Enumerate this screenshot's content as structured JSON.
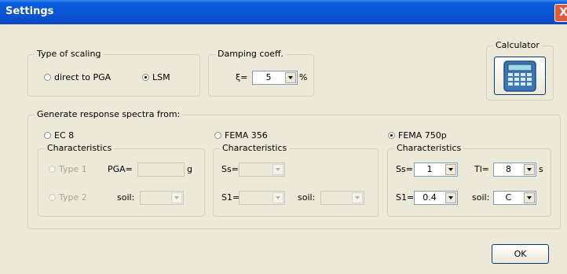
{
  "window": {
    "title": "Settings",
    "close_glyph": "X"
  },
  "scaling": {
    "legend": "Type of scaling",
    "opt1": "direct to PGA",
    "opt2": "LSM",
    "selected": "LSM"
  },
  "damping": {
    "legend": "Damping coeff.",
    "symbol": "ξ=",
    "value": "5",
    "unit": "%"
  },
  "calculator": {
    "label": "Calculator",
    "icon": "calculator-icon"
  },
  "generate": {
    "legend": "Generate response spectra from:"
  },
  "ec8": {
    "label": "EC 8",
    "selected": false,
    "characteristics": "Characteristics",
    "type1": "Type 1",
    "pga_label": "PGA=",
    "pga_unit": "g",
    "type2": "Type 2",
    "soil_label": "soil:"
  },
  "fema356": {
    "label": "FEMA 356",
    "selected": false,
    "characteristics": "Characteristics",
    "ss_label": "Ss=",
    "s1_label": "S1=",
    "soil_label": "soil:"
  },
  "fema750": {
    "label": "FEMA 750p",
    "selected": true,
    "characteristics": "Characteristics",
    "ss_label": "Ss=",
    "ss_value": "1",
    "tl_label": "Tl=",
    "tl_value": "8",
    "tl_unit": "s",
    "s1_label": "S1=",
    "s1_value": "0.4",
    "soil_label": "soil:",
    "soil_value": "C"
  },
  "ok_label": "OK"
}
